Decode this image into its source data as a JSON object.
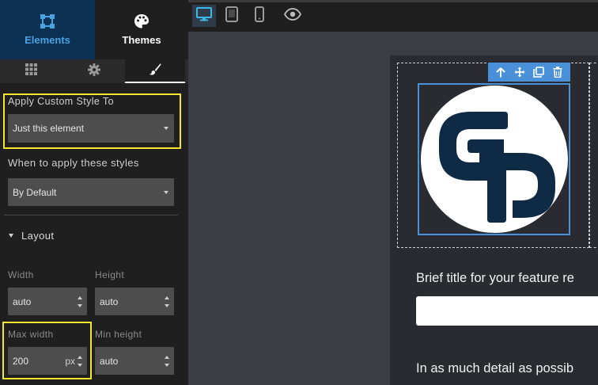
{
  "sidebar": {
    "tabs": [
      {
        "label": "Elements",
        "icon": "elements-icon",
        "active": true
      },
      {
        "label": "Themes",
        "icon": "palette-icon",
        "active": false
      }
    ],
    "subtabs": [
      {
        "icon": "grid-icon"
      },
      {
        "icon": "gear-icon"
      },
      {
        "icon": "paintbrush-icon",
        "active": true
      }
    ],
    "apply_custom_style": {
      "label": "Apply Custom Style To",
      "value": "Just this element"
    },
    "when_to_apply": {
      "label": "When to apply these styles",
      "value": "By Default"
    },
    "layout": {
      "title": "Layout",
      "width": {
        "label": "Width",
        "value": "auto"
      },
      "height": {
        "label": "Height",
        "value": "auto"
      },
      "max_width": {
        "label": "Max width",
        "value": "200",
        "unit": "px"
      },
      "min_height": {
        "label": "Min height",
        "value": "auto"
      }
    }
  },
  "topbar": {
    "icons": [
      "desktop-icon",
      "tablet-icon",
      "mobile-icon",
      "eye-icon"
    ]
  },
  "canvas": {
    "logo_toolbar": [
      "arrow-up-icon",
      "move-icon",
      "duplicate-icon",
      "trash-icon"
    ],
    "field_title": "Brief title for your feature re",
    "field_description": "In as much detail as possib"
  },
  "colors": {
    "accent": "#4a90d9",
    "highlight": "#f3e62c",
    "logo_navy": "#0e2a45",
    "active_tab_bg": "#0d3153"
  }
}
